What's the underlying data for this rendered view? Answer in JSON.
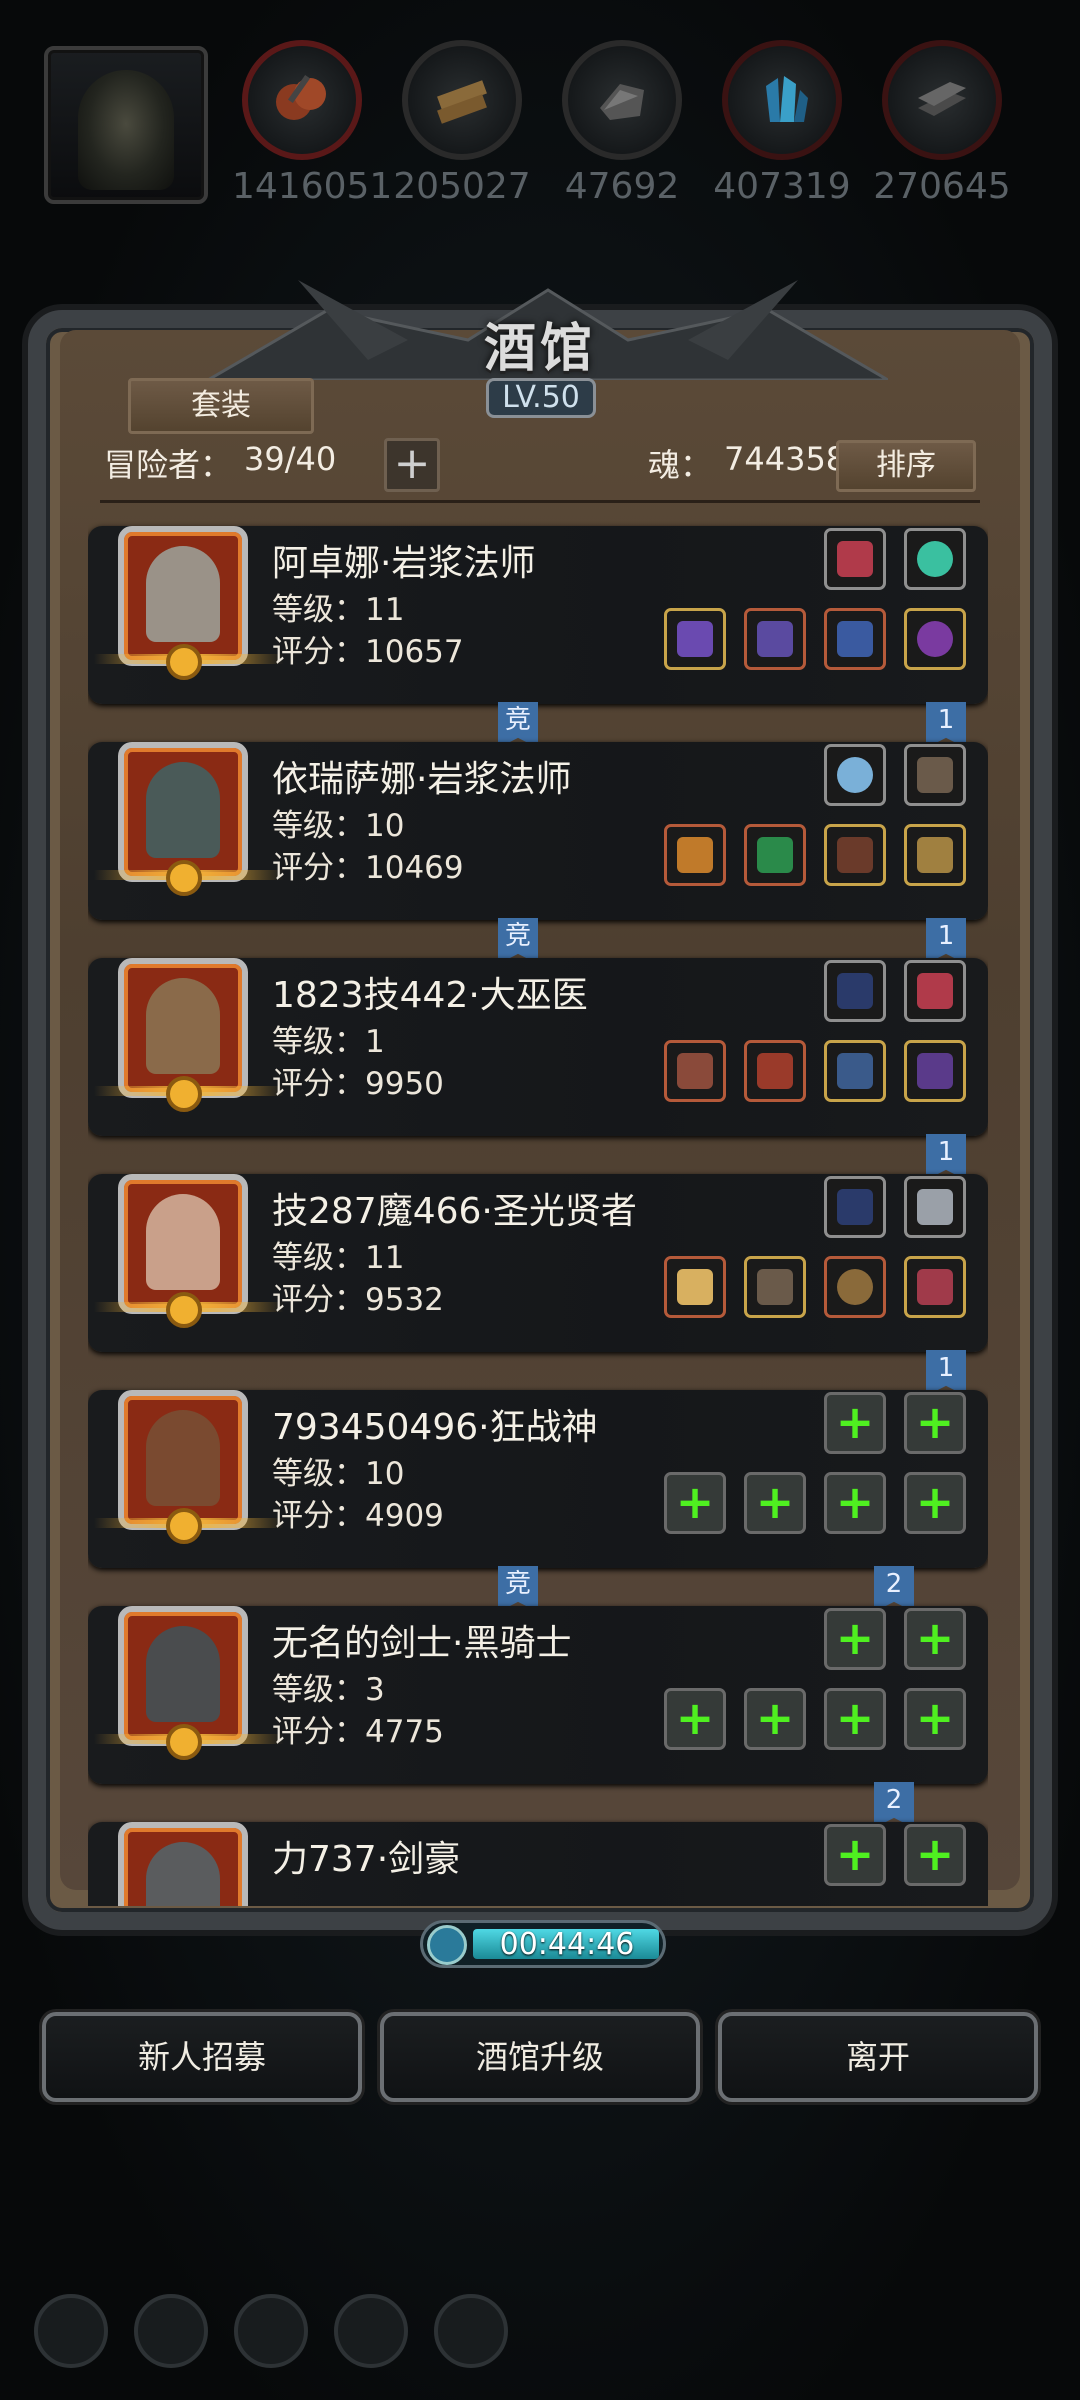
{
  "resources": {
    "items": [
      {
        "value": "1416051",
        "icon": "ore-icon",
        "ring_color": "#5a1818"
      },
      {
        "value": "205027",
        "icon": "wood-icon",
        "ring_color": "#2a2a2a"
      },
      {
        "value": "47692",
        "icon": "stone-icon",
        "ring_color": "#2a2a2a"
      },
      {
        "value": "407319",
        "icon": "crystal-icon",
        "ring_color": "#3a1212"
      },
      {
        "value": "270645",
        "icon": "iron-icon",
        "ring_color": "#3a1212"
      }
    ]
  },
  "tavern": {
    "title": "酒馆",
    "level": "LV.50",
    "suit_label": "套装",
    "adventurer_label": "冒险者：",
    "adventurer_value": "39/40",
    "plus_label": "+",
    "soul_label": "魂：",
    "soul_value": "744358",
    "sort_label": "排序",
    "timer": "00:44:46"
  },
  "heroes": [
    {
      "name": "阿卓娜·岩浆法师",
      "level": "等级：11",
      "score": "评分：10657",
      "tag_left": "竞",
      "tag_right": "1",
      "face": "#9a9288"
    },
    {
      "name": "依瑞萨娜·岩浆法师",
      "level": "等级：10",
      "score": "评分：10469",
      "tag_left": "竞",
      "tag_right": "1",
      "face": "#4a5a58"
    },
    {
      "name": "1823技442·大巫医",
      "level": "等级：1",
      "score": "评分：9950",
      "tag_left": "",
      "tag_right": "1",
      "face": "#8a6a4a"
    },
    {
      "name": "技287魔466·圣光贤者",
      "level": "等级：11",
      "score": "评分：9532",
      "tag_left": "",
      "tag_right": "1",
      "face": "#c9a08a"
    },
    {
      "name": "793450496·狂战神",
      "level": "等级：10",
      "score": "评分：4909",
      "tag_left": "竞",
      "tag_right": "2",
      "face": "#7a4a30"
    },
    {
      "name": "无名的剑士·黑骑士",
      "level": "等级：3",
      "score": "评分：4775",
      "tag_left": "",
      "tag_right": "2",
      "face": "#4a4c4e"
    },
    {
      "name": "力737·剑豪",
      "level": "",
      "score": "",
      "tag_left": "",
      "tag_right": "",
      "face": "#5a5c5e"
    }
  ],
  "buttons": {
    "recruit": "新人招募",
    "upgrade": "酒馆升级",
    "leave": "离开"
  },
  "colors": {
    "accent_blue": "#3d6ea5",
    "plus_green": "#4ff020",
    "timer_cyan": "#4fd8e4"
  }
}
